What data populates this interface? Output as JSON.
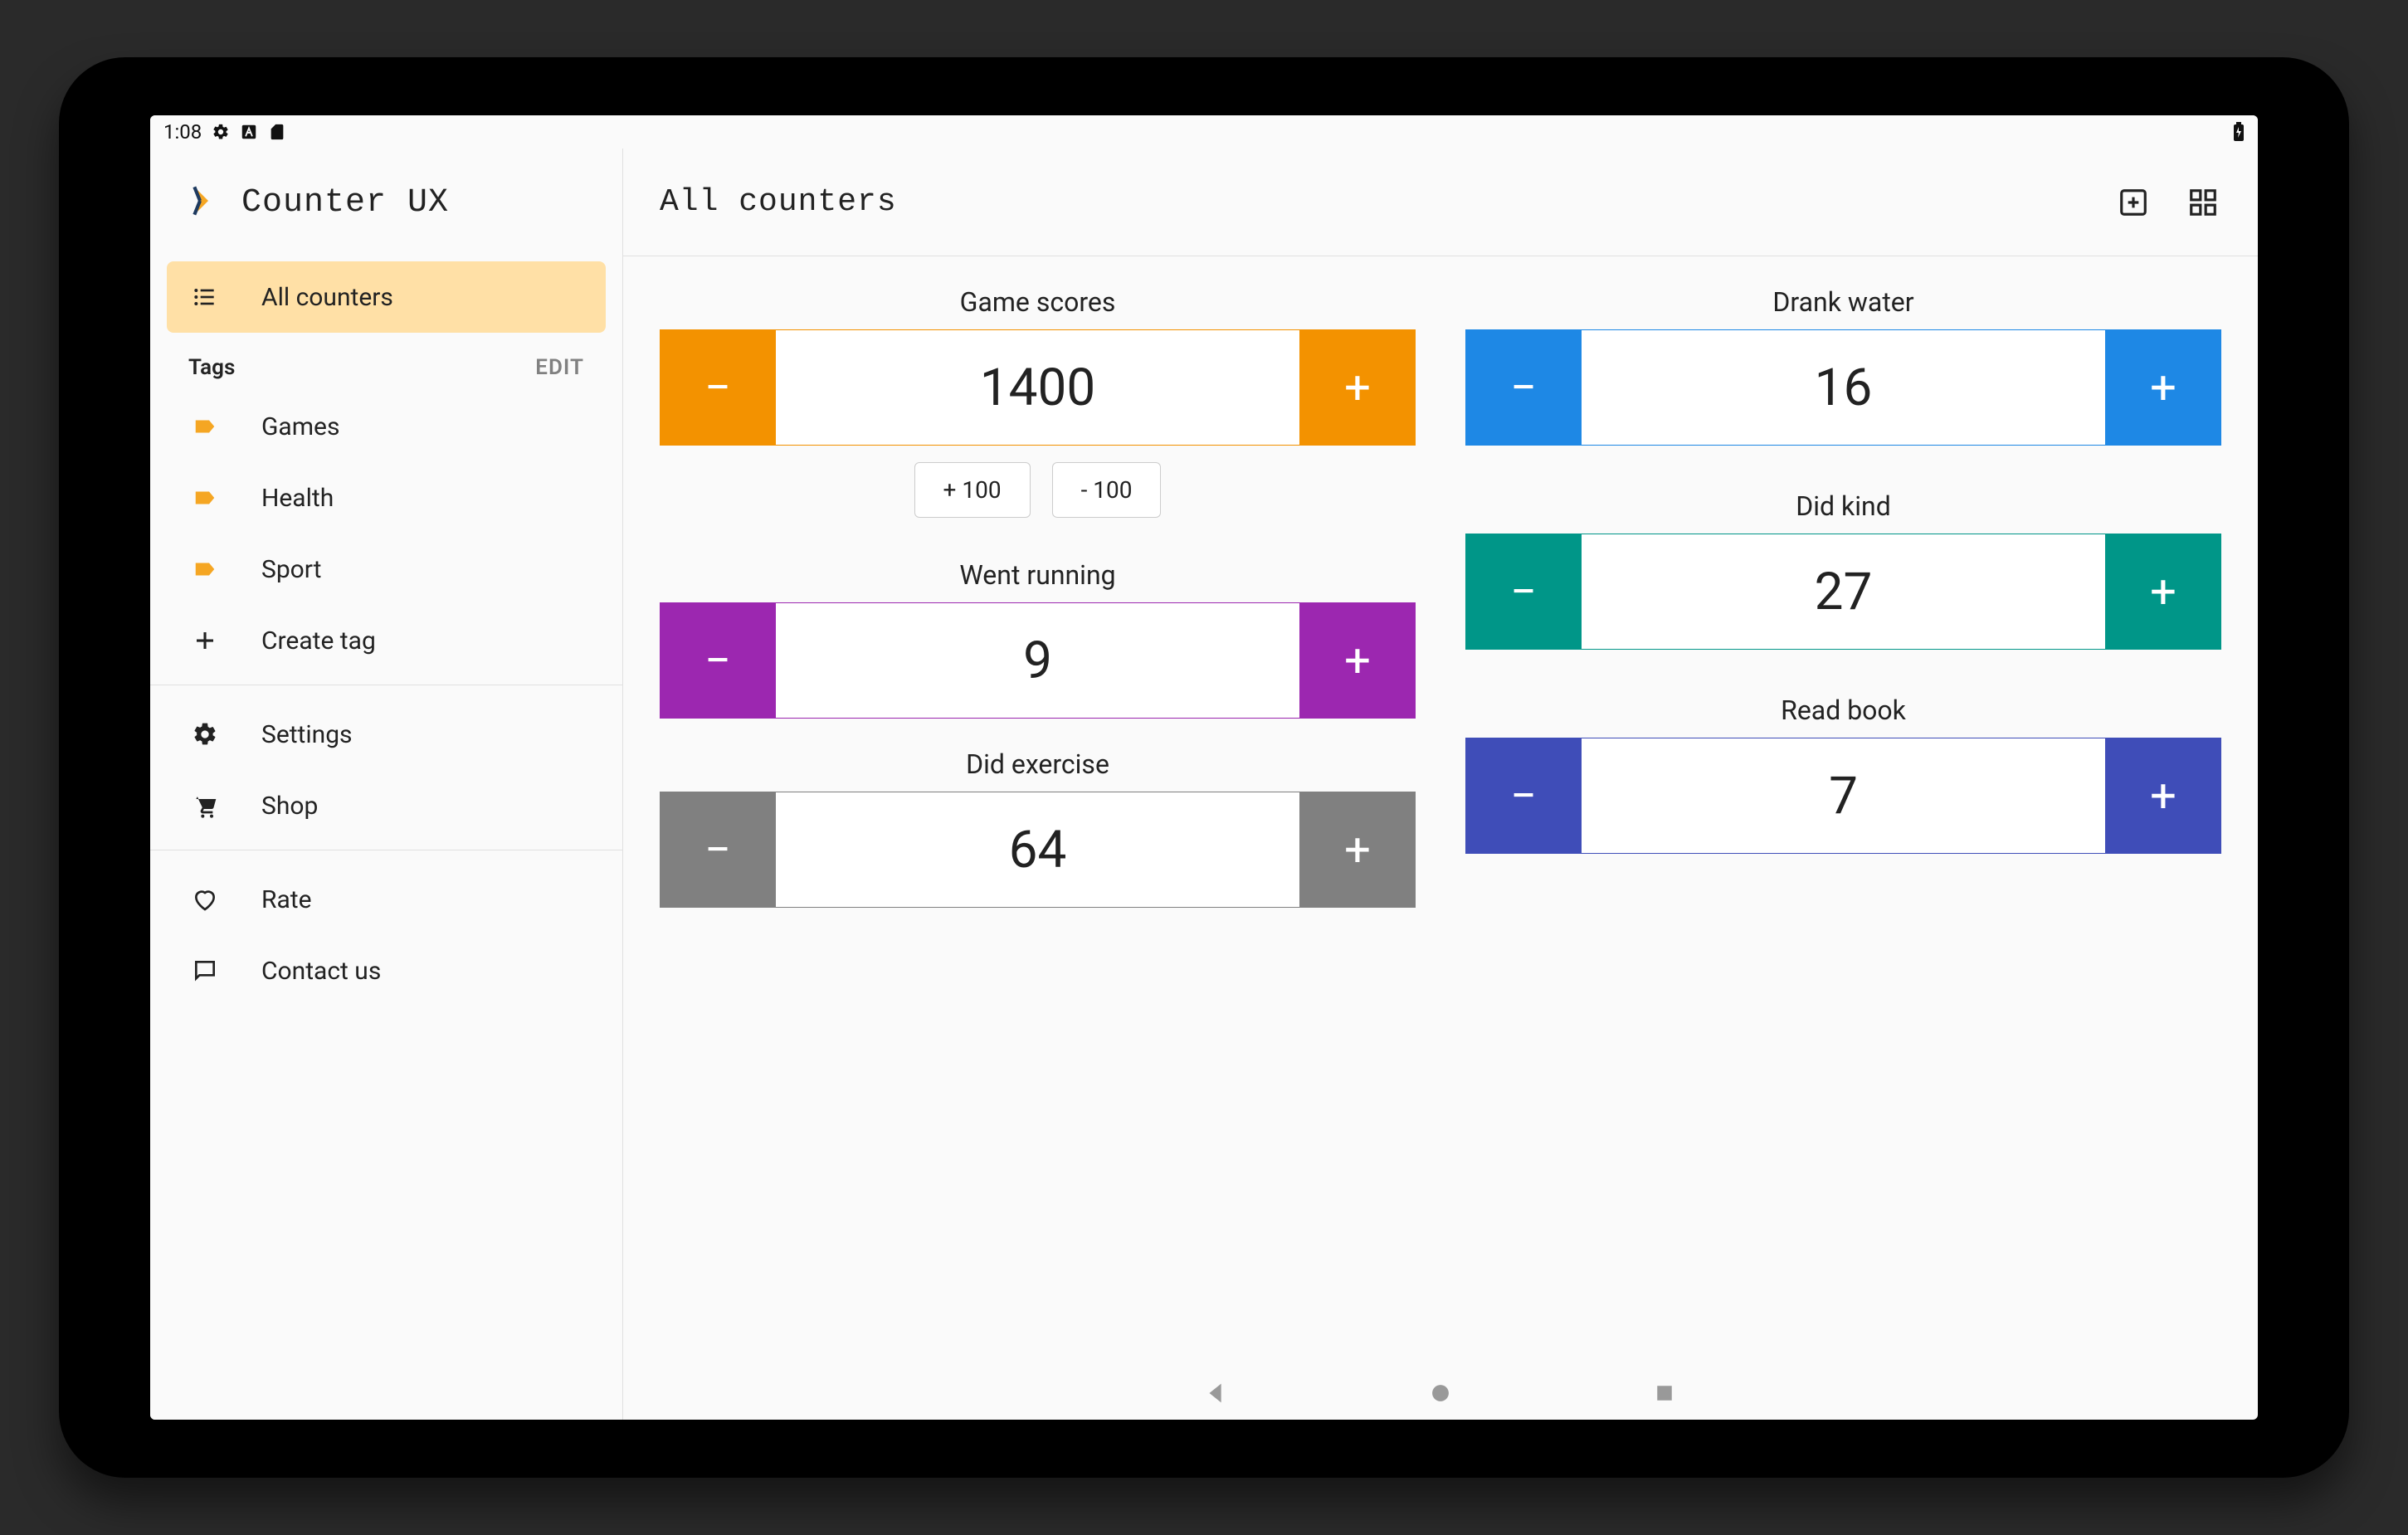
{
  "status": {
    "time": "1:08"
  },
  "sidebar": {
    "app_title": "Counter UX",
    "primary": {
      "label": "All counters"
    },
    "tags": {
      "header": "Tags",
      "edit": "EDIT",
      "items": [
        {
          "label": "Games"
        },
        {
          "label": "Health"
        },
        {
          "label": "Sport"
        }
      ],
      "create": "Create tag"
    },
    "settings": "Settings",
    "shop": "Shop",
    "rate": "Rate",
    "contact": "Contact us"
  },
  "header": {
    "title": "All counters"
  },
  "colors": {
    "orange": "#f39200",
    "purple": "#9c27b0",
    "gray": "#808080",
    "blue": "#1e88e5",
    "teal": "#009688",
    "indigo": "#3f4db8",
    "activeNav": "#ffe0a6",
    "tagIcon": "#f5a623"
  },
  "counters": {
    "left": [
      {
        "title": "Game scores",
        "value": "1400",
        "color_key": "orange",
        "extra": [
          "+ 100",
          "- 100"
        ]
      },
      {
        "title": "Went running",
        "value": "9",
        "color_key": "purple"
      },
      {
        "title": "Did exercise",
        "value": "64",
        "color_key": "gray"
      }
    ],
    "right": [
      {
        "title": "Drank water",
        "value": "16",
        "color_key": "blue"
      },
      {
        "title": "Did kind",
        "value": "27",
        "color_key": "teal"
      },
      {
        "title": "Read book",
        "value": "7",
        "color_key": "indigo"
      }
    ]
  }
}
